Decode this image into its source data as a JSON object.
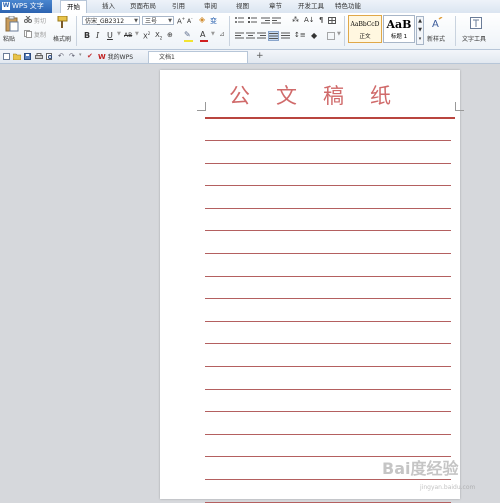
{
  "app": {
    "logo": "W",
    "name": "WPS 文字"
  },
  "menu": {
    "items": [
      "开始",
      "插入",
      "页面布局",
      "引用",
      "审阅",
      "视图",
      "章节",
      "开发工具",
      "特色功能"
    ],
    "active_index": 0
  },
  "ribbon": {
    "paste": "粘贴",
    "cut": "剪切",
    "copy": "复制",
    "format_painter": "格式刷",
    "font_name": "仿宋_GB2312",
    "font_size": "三号",
    "styles": [
      {
        "preview": "AaBbCcD",
        "label": "正文"
      },
      {
        "preview": "AaB",
        "label": "标题 1"
      }
    ],
    "new_style": "新样式",
    "text_tools": "文字工具"
  },
  "quickbar": {
    "tabs": [
      {
        "label": "我的WPS"
      },
      {
        "label": "文档1"
      }
    ],
    "new_tab": "+"
  },
  "document": {
    "title": "公文稿纸",
    "line_count": 17
  },
  "watermark": {
    "text": "Bai度经验",
    "sub": "jingyan.baidu.com"
  },
  "colors": {
    "accent": "#2c63b0",
    "title_red": "#d06a6a",
    "rule": "#b46060"
  }
}
